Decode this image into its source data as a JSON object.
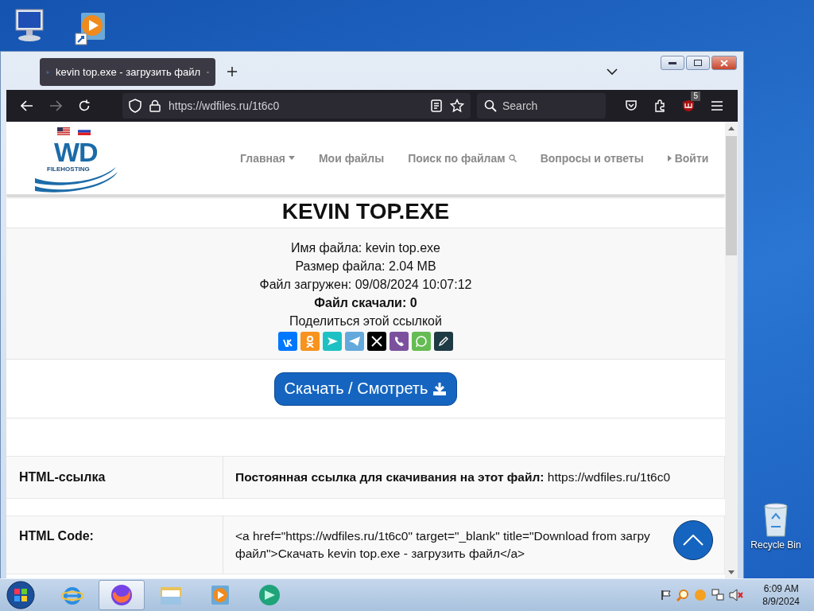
{
  "desktop": {
    "recycle_bin": {
      "label": "Recycle Bin"
    }
  },
  "browser": {
    "tabs": [
      {
        "title": "kevin top.exe - загрузить файл",
        "selected": true
      }
    ],
    "address": "https://wdfiles.ru/1t6c0",
    "search": {
      "placeholder": "Search"
    },
    "extension_badge": "5"
  },
  "page": {
    "logo": {
      "mark": "WD",
      "tagline": "FILEHOSTING"
    },
    "nav": [
      {
        "label": "Главная",
        "kind": "dropdown"
      },
      {
        "label": "Мои файлы",
        "kind": "plain"
      },
      {
        "label": "Поиск по файлам",
        "kind": "search"
      },
      {
        "label": "Вопросы и ответы",
        "kind": "plain"
      },
      {
        "label": "Войти",
        "kind": "login"
      }
    ],
    "title": "KEVIN TOP.EXE",
    "info": [
      {
        "text": "Имя файла: kevin top.exe",
        "bold": false
      },
      {
        "text": "Размер файла: 2.04 MB",
        "bold": false
      },
      {
        "text": "Файл загружен: 09/08/2024 10:07:12",
        "bold": false
      },
      {
        "text": "Файл скачали: 0",
        "bold": true
      },
      {
        "text": "Поделиться этой ссылкой",
        "bold": false
      }
    ],
    "share": [
      {
        "kind": "letters",
        "color": "#0077ff"
      },
      {
        "kind": "person",
        "color": "#f7931e"
      },
      {
        "kind": "arrow",
        "color": "#1ec1c3"
      },
      {
        "kind": "plane",
        "color": "#64a9dc"
      },
      {
        "kind": "x",
        "color": "#000000"
      },
      {
        "kind": "phone",
        "color": "#7b519d"
      },
      {
        "kind": "chat",
        "color": "#65bc54"
      },
      {
        "kind": "pencil",
        "color": "#1e3a44"
      }
    ],
    "download_button": "Скачать / Смотреть",
    "table": [
      {
        "label": "HTML-ссылка",
        "lines": [
          "**Постоянная ссылка для скачивания на этот файл:** https://wdfiles.ru/1t6c0"
        ]
      },
      {
        "label": "HTML Code:",
        "lines": [
          "<a href=\"https://wdfiles.ru/1t6c0\" target=\"_blank\" title=\"Download from загру",
          "файл\">Скачать kevin top.exe - загрузить файл</a>"
        ]
      }
    ]
  },
  "taskbar": {
    "apps": [
      {
        "kind": "browser-e",
        "selected": false
      },
      {
        "kind": "browser-fox",
        "selected": true
      },
      {
        "kind": "folder",
        "selected": false
      },
      {
        "kind": "player",
        "selected": false
      },
      {
        "kind": "app",
        "selected": false
      }
    ],
    "clock": {
      "time": "6:09 AM",
      "date": "8/9/2024"
    }
  }
}
